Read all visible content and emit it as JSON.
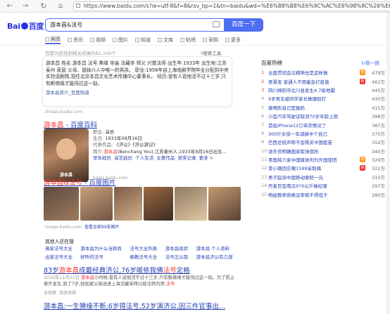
{
  "browser": {
    "url": "https://www.baidu.com/s?ie=utf-8&f=8&rsv_bp=1&tn=baidu&wd=%E6%B8%B8%E6%9C%AC%E6%98%8C%26%E6%B3%95%E5%8F%B7"
  },
  "header": {
    "logo": "Bai🐾百度",
    "logo_left": "Bai",
    "logo_right": "百度",
    "query": "游本昌&法号",
    "search_button": "百度一下",
    "tabs": [
      "网页",
      "资讯",
      "视频",
      "图片",
      "知道",
      "文库",
      "贴吧",
      "采购",
      "更多"
    ]
  },
  "stats": "百度为您找到相关结果约81,100个",
  "tools": "搜索工具",
  "result1": {
    "text": "游本昌 姓名 游本昌 法号 弗缘 寺庙 法藏寺 师父 兴慈法师 出生年:1933年 出生地:江苏泰州 家庭 父母、姐妹六人中唯一的男孩。 职业:1956年自上海戏剧学院毕业分配到中央实验话剧院,现任北京本昌文化艺术传播中心董事长。 经历:曾有人说他活不过十三岁,只有断佛缘才能闯过这一劫。",
    "sub": "游本昌简介_百度知道",
    "source": "zhidao.baidu.com"
  },
  "baike": {
    "title_em": "游本昌",
    "title_rest": " - 百度百科",
    "image_caption": "游本昌",
    "job_label": "职业:",
    "job": "演员",
    "birth_label": "生日:",
    "birth": "1933年09月16日",
    "works_label": "代表作品:",
    "works": "《济公》《济公游记》",
    "intro_label": "简介:",
    "intro_em": "游本昌",
    "intro": "(Benchang You),江苏泰州人,1933年9月16日出生...",
    "links": [
      "早年经历",
      "演艺经历",
      "个人生活",
      "主要作品",
      "获奖记录",
      "更多 >"
    ],
    "source": "baike.baidu.com"
  },
  "images": {
    "title_em": "游本昌&法号",
    "title_rest": " - 百度图片",
    "source": "image.baidu.com",
    "more": "查看全部99张图片",
    "colors": [
      "#5a4a3f",
      "#c9a27a",
      "#7b5b46",
      "#9d6b43",
      "#8e7a62",
      "#c49a70"
    ]
  },
  "related": {
    "title": "其他人还在搜",
    "items": [
      "佛家法号大全",
      "游本昌为什么当和尚",
      "法号大全列表",
      "游本昌现状",
      "游本昌 个人资料",
      "出家法号大全",
      "好听的法号",
      "佛教法号大全",
      "法号怎么取",
      "游本昌济公有几部"
    ]
  },
  "news": {
    "title_pre": "83岁",
    "title_em": "游本昌",
    "title_mid": "成最经典济公,76岁皈依我佛",
    "title_em2": "法号",
    "title_end": "定格",
    "date": "2016年11月22日",
    "text_pre": "游本昌",
    "text": "小时候,曾有人说他活不过十三岁,只有断佛缘才能闯过这一劫。为了防止意外发生,到了7岁,他就被父母送进上海法藏寺拜兴慈法师为师,",
    "text_em": "法号",
    "source": "业观察",
    "date2": "百度快照"
  },
  "last_title": "游本昌:一生獐缘不断,6岁得法号,52岁演济公,因三件官事出...",
  "hot": {
    "title": "百度热榜",
    "refresh": "换一换",
    "items": [
      {
        "rank": "1",
        "text": "全面贯彻会议精神总是这样做",
        "num": "479万",
        "badge": "热",
        "badge_color": "#ff9812"
      },
      {
        "rank": "2",
        "text": "吴慧发 普通人不用着急打疫苗",
        "num": "462万",
        "badge": "新",
        "badge_color": "#f73131"
      },
      {
        "rank": "3",
        "text": "四川绵阳市北川县发生4.7级地震",
        "num": "445万",
        "badge": "",
        "badge_color": ""
      },
      {
        "rank": "4",
        "text": "9岁男生被同学家长推撞殴打",
        "num": "430万",
        "badge": "",
        "badge_color": ""
      },
      {
        "rank": "5",
        "text": "微喝形自己是猩妈",
        "num": "415万",
        "badge": "",
        "badge_color": ""
      },
      {
        "rank": "6",
        "text": "小型汽车驾驶证取消70岁年龄上限",
        "num": "398万",
        "badge": "",
        "badge_color": ""
      },
      {
        "rank": "7",
        "text": "首批iPhone12订单货情况了",
        "num": "387万",
        "badge": "",
        "badge_color": ""
      },
      {
        "rank": "8",
        "text": "300斤女孩一年减掉半个自己",
        "num": "370万",
        "badge": "",
        "badge_color": ""
      },
      {
        "rank": "9",
        "text": "巴西总统声称不会购买中国疫苗",
        "num": "352万",
        "badge": "",
        "badge_color": ""
      },
      {
        "rank": "10",
        "text": "读外贸明确国家取场宿所",
        "num": "340万",
        "badge": "",
        "badge_color": ""
      },
      {
        "rank": "11",
        "text": "美国将六家中国媒体列为外国使团",
        "num": "329万",
        "badge": "新",
        "badge_color": "#ff9812"
      },
      {
        "rank": "12",
        "text": "李小璐回应嘲1599采取偶",
        "num": "322万",
        "badge": "热",
        "badge_color": "#f73131"
      },
      {
        "rank": "13",
        "text": "男子起诉中国移动索赔一元",
        "num": "310万",
        "badge": "",
        "badge_color": ""
      },
      {
        "rank": "14",
        "text": "丹麦巨型南瓜970公斤破纪录",
        "num": "297万",
        "badge": "",
        "badge_color": ""
      },
      {
        "rank": "15",
        "text": "明经教师资格证审核不得低于",
        "num": "280万",
        "badge": "",
        "badge_color": ""
      }
    ]
  }
}
